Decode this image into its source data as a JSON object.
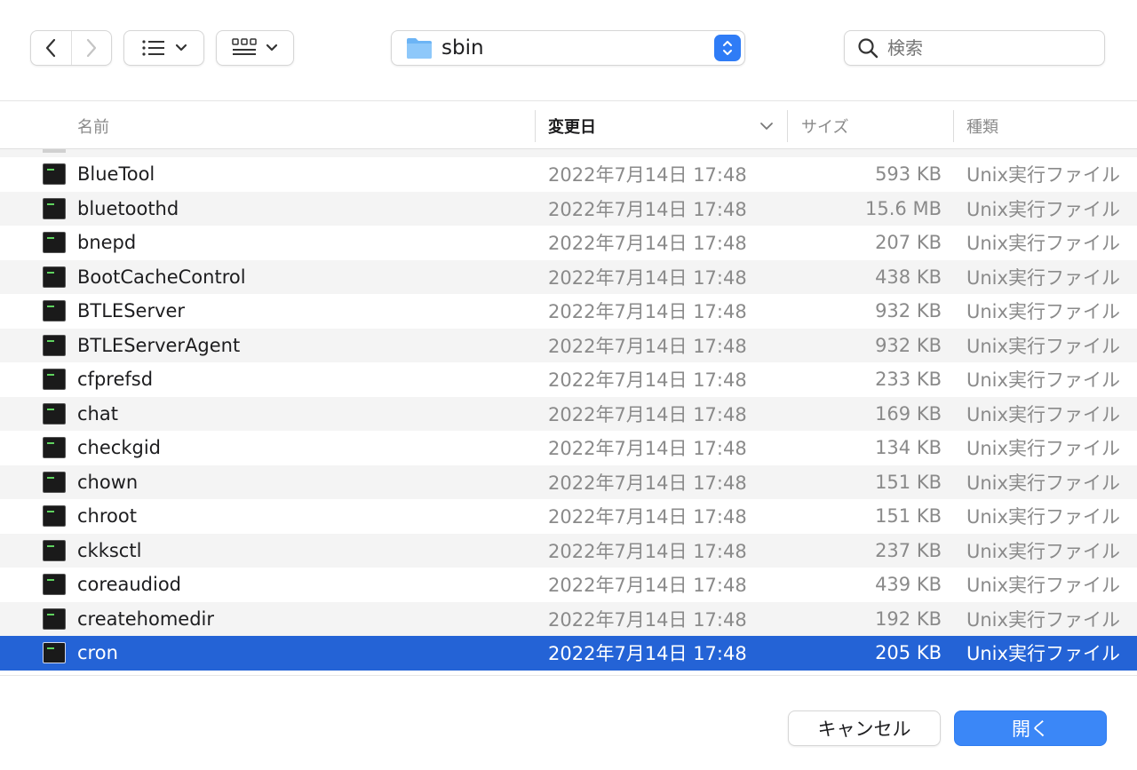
{
  "toolbar": {
    "path_folder": "sbin",
    "search_placeholder": "検索"
  },
  "columns": {
    "name": "名前",
    "date": "変更日",
    "size": "サイズ",
    "kind": "種類"
  },
  "files": [
    {
      "name": "BlueTool",
      "date": "2022年7月14日 17:48",
      "size": "593 KB",
      "kind": "Unix実行ファイル"
    },
    {
      "name": "bluetoothd",
      "date": "2022年7月14日 17:48",
      "size": "15.6 MB",
      "kind": "Unix実行ファイル"
    },
    {
      "name": "bnepd",
      "date": "2022年7月14日 17:48",
      "size": "207 KB",
      "kind": "Unix実行ファイル"
    },
    {
      "name": "BootCacheControl",
      "date": "2022年7月14日 17:48",
      "size": "438 KB",
      "kind": "Unix実行ファイル"
    },
    {
      "name": "BTLEServer",
      "date": "2022年7月14日 17:48",
      "size": "932 KB",
      "kind": "Unix実行ファイル"
    },
    {
      "name": "BTLEServerAgent",
      "date": "2022年7月14日 17:48",
      "size": "932 KB",
      "kind": "Unix実行ファイル"
    },
    {
      "name": "cfprefsd",
      "date": "2022年7月14日 17:48",
      "size": "233 KB",
      "kind": "Unix実行ファイル"
    },
    {
      "name": "chat",
      "date": "2022年7月14日 17:48",
      "size": "169 KB",
      "kind": "Unix実行ファイル"
    },
    {
      "name": "checkgid",
      "date": "2022年7月14日 17:48",
      "size": "134 KB",
      "kind": "Unix実行ファイル"
    },
    {
      "name": "chown",
      "date": "2022年7月14日 17:48",
      "size": "151 KB",
      "kind": "Unix実行ファイル"
    },
    {
      "name": "chroot",
      "date": "2022年7月14日 17:48",
      "size": "151 KB",
      "kind": "Unix実行ファイル"
    },
    {
      "name": "ckksctl",
      "date": "2022年7月14日 17:48",
      "size": "237 KB",
      "kind": "Unix実行ファイル"
    },
    {
      "name": "coreaudiod",
      "date": "2022年7月14日 17:48",
      "size": "439 KB",
      "kind": "Unix実行ファイル"
    },
    {
      "name": "createhomedir",
      "date": "2022年7月14日 17:48",
      "size": "192 KB",
      "kind": "Unix実行ファイル"
    },
    {
      "name": "cron",
      "date": "2022年7月14日 17:48",
      "size": "205 KB",
      "kind": "Unix実行ファイル",
      "selected": true
    }
  ],
  "footer": {
    "cancel_label": "キャンセル",
    "open_label": "開く"
  },
  "colors": {
    "selection": "#2463d6",
    "accent": "#3b87f7",
    "alt_row": "#f4f4f4"
  },
  "icons": [
    "chevron-left-icon",
    "chevron-right-icon",
    "list-view-icon",
    "grid-view-icon",
    "folder-icon",
    "stepper-icon",
    "search-icon",
    "sort-chevron-down-icon",
    "terminal-exec-icon"
  ]
}
